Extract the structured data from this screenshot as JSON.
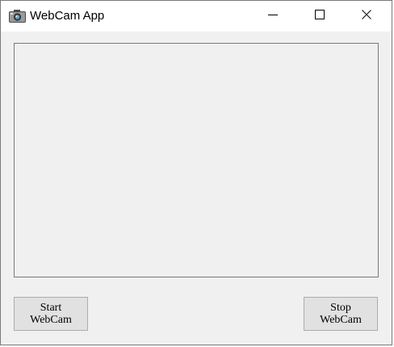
{
  "window": {
    "title": "WebCam App",
    "app_icon": "camera-icon"
  },
  "titlebar_buttons": {
    "minimize": "minimize-icon",
    "maximize": "maximize-icon",
    "close": "close-icon"
  },
  "buttons": {
    "start_label": "Start\nWebCam",
    "stop_label": "Stop\nWebCam"
  },
  "colors": {
    "window_bg": "#f0f0f0",
    "titlebar_bg": "#ffffff",
    "button_bg": "#e1e1e1",
    "border": "#7a7a7a"
  }
}
